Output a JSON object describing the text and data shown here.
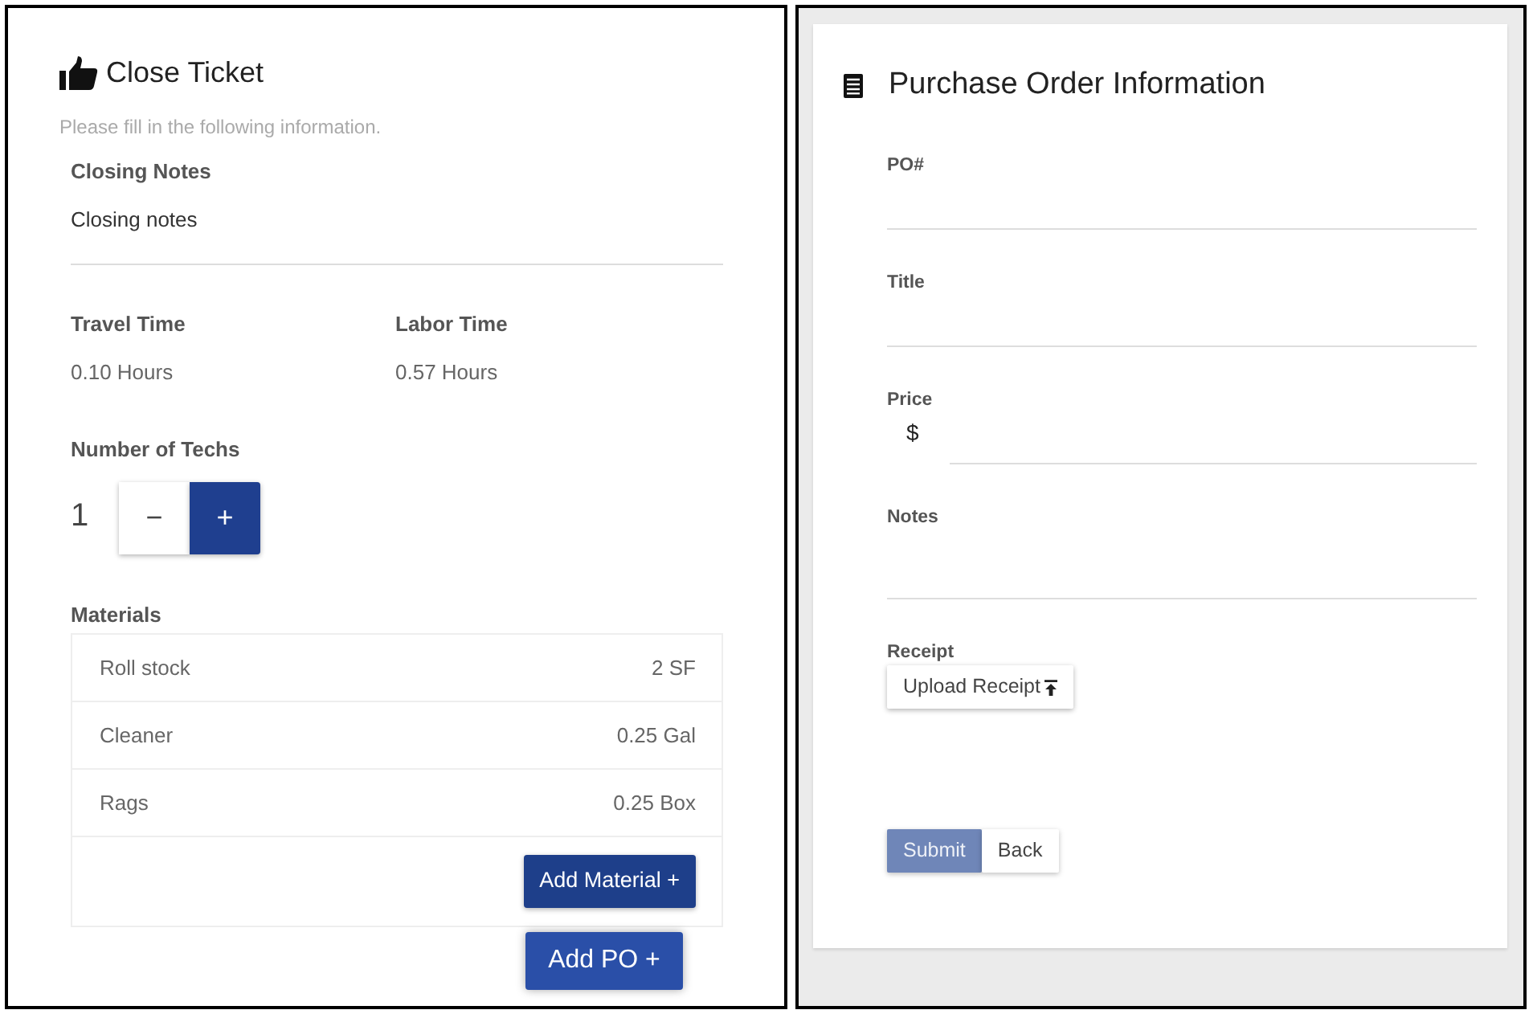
{
  "ticket": {
    "title": "Close Ticket",
    "subtitle": "Please fill in the following information.",
    "closing_notes": {
      "label": "Closing Notes",
      "value": "Closing notes"
    },
    "times": [
      {
        "label": "Travel Time",
        "value": "0.10 Hours"
      },
      {
        "label": "Labor Time",
        "value": "0.57 Hours"
      }
    ],
    "techs": {
      "label": "Number of Techs",
      "value": "1",
      "decrement": "−",
      "increment": "+"
    },
    "materials": {
      "label": "Materials",
      "items": [
        {
          "name": "Roll stock",
          "quantity": "2 SF"
        },
        {
          "name": "Cleaner",
          "quantity": "0.25 Gal"
        },
        {
          "name": "Rags",
          "quantity": "0.25 Box"
        }
      ],
      "add_button": "Add Material +"
    },
    "add_po_button": "Add PO +"
  },
  "purchase_order": {
    "title": "Purchase Order Information",
    "fields": [
      {
        "kind": "text",
        "label": "PO#"
      },
      {
        "kind": "text",
        "label": "Title"
      },
      {
        "kind": "currency",
        "label": "Price",
        "prefix": "$"
      },
      {
        "kind": "textarea",
        "label": "Notes"
      },
      {
        "kind": "file",
        "label": "Receipt",
        "button": "Upload Receipt"
      }
    ],
    "actions": [
      {
        "kind": "primary",
        "label": "Submit",
        "disabled": true
      },
      {
        "kind": "secondary",
        "label": "Back",
        "disabled": false
      }
    ]
  }
}
